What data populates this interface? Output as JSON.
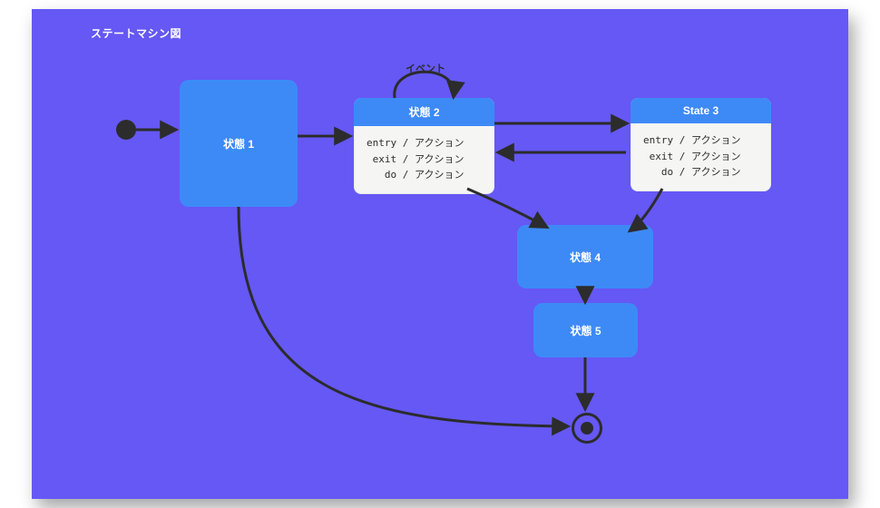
{
  "title": "ステートマシン図",
  "states": {
    "s1": {
      "label": "状態 1"
    },
    "s2": {
      "label": "状態 2",
      "actions": [
        {
          "kind": "entry",
          "act": "アクション"
        },
        {
          "kind": "exit",
          "act": "アクション"
        },
        {
          "kind": "do",
          "act": "アクション"
        }
      ]
    },
    "s3": {
      "label": "State 3",
      "actions": [
        {
          "kind": "entry",
          "act": "アクション"
        },
        {
          "kind": "exit",
          "act": "アクション"
        },
        {
          "kind": "do",
          "act": "アクション"
        }
      ]
    },
    "s4": {
      "label": "状態 4"
    },
    "s5": {
      "label": "状態 5"
    }
  },
  "edges": {
    "self2": {
      "label": "イベント"
    }
  }
}
